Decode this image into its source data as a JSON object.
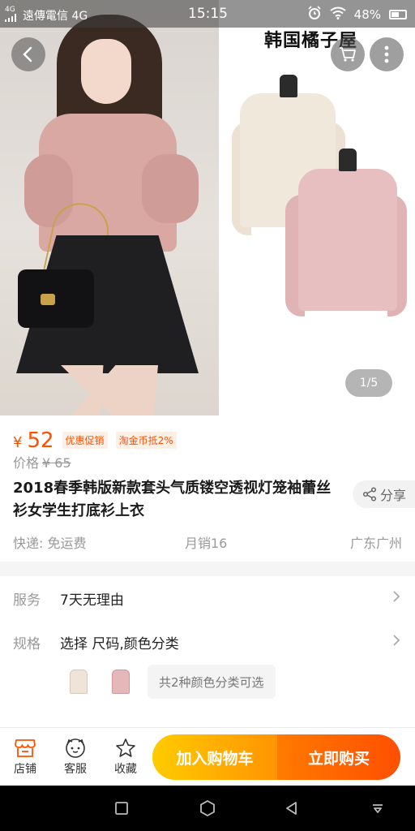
{
  "status_bar": {
    "signal_label": "4G",
    "carrier": "遠傳電信 4G",
    "time": "15:15",
    "battery": "48%"
  },
  "hero": {
    "brand_overlay": "韩国橘子屋",
    "pager": "1/5"
  },
  "product": {
    "currency": "¥",
    "price": "52",
    "promo_tags": [
      "优惠促销",
      "淘金币抵2%"
    ],
    "original_price_label": "价格",
    "original_price": "¥ 65",
    "title": "2018春季韩版新款套头气质镂空透视灯笼袖蕾丝衫女学生打底衫上衣",
    "share_label": "分享",
    "shipping": "快递: 免运费",
    "monthly_sales": "月销16",
    "location": "广东广州"
  },
  "options": {
    "service_label": "服务",
    "service_value": "7天无理由",
    "spec_label": "规格",
    "spec_value": "选择 尺码,颜色分类",
    "color_count_text": "共2种颜色分类可选"
  },
  "bottom_bar": {
    "store_label": "店铺",
    "service_label": "客服",
    "favorite_label": "收藏",
    "add_to_cart": "加入购物车",
    "buy_now": "立即购买"
  },
  "colors": {
    "accent": "#ff4f00",
    "cart_gradient_start": "#ffcb00",
    "buy_gradient_end": "#ff4f00"
  }
}
